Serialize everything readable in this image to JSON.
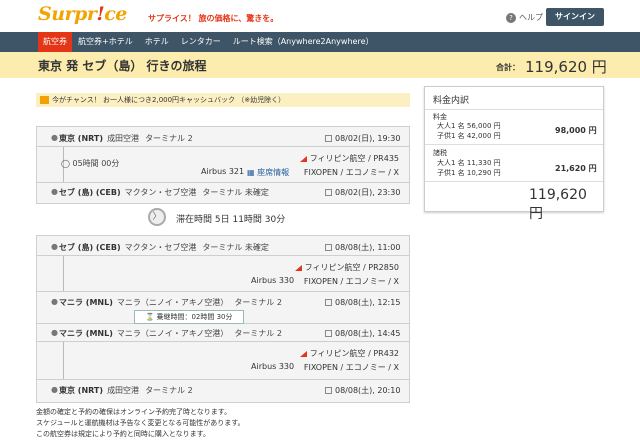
{
  "header": {
    "logo": "Surpr",
    "logo_ex": "!",
    "logo_tail": "ce",
    "tagline": "サプライス！ 旅の価格に、驚きを。",
    "help": "ヘルプ",
    "help_icon": "?",
    "signin": "サインイン"
  },
  "nav": [
    {
      "label": "航空券",
      "active": true
    },
    {
      "label": "航空券+ホテル",
      "active": false
    },
    {
      "label": "ホテル",
      "active": false
    },
    {
      "label": "レンタカー",
      "active": false
    },
    {
      "label": "ルート検索（Anywhere2Anywhere）",
      "active": false
    }
  ],
  "title": "東京 発 セブ（島） 行きの旅程",
  "total": {
    "label": "合計：",
    "value": "119,620 円"
  },
  "promo": "今がチャンス！ お一人様につき2,000円キャッシュバック （※幼児除く）",
  "outbound": {
    "from": {
      "city": "東京 (NRT)",
      "airport": "成田空港",
      "terminal": "ターミナル 2",
      "datetime": "08/02(日), 19:30"
    },
    "duration": "05時間 00分",
    "airline": "フィリピン航空",
    "flight": "PR435",
    "aircraft": "Airbus 321",
    "seat": "座席情報",
    "fare": "FIXOPEN",
    "cabin": "エコノミー",
    "cls": "X",
    "to": {
      "city": "セブ (島) (CEB)",
      "airport": "マクタン・セブ空港",
      "terminal": "ターミナル 未確定",
      "datetime": "08/02(日), 23:30"
    }
  },
  "stay": {
    "icon": "〉",
    "label": "滞在時間",
    "value": "5日 11時間 30分"
  },
  "return1": {
    "from": {
      "city": "セブ (島) (CEB)",
      "airport": "マクタン・セブ空港",
      "terminal": "ターミナル 未確定",
      "datetime": "08/08(土), 11:00"
    },
    "airline": "フィリピン航空",
    "flight": "PR2850",
    "aircraft": "Airbus 330",
    "fare": "FIXOPEN",
    "cabin": "エコノミー",
    "cls": "X",
    "to": {
      "city": "マニラ (MNL)",
      "airport": "マニラ（ニノイ・アキノ空港）",
      "terminal": "ターミナル 2",
      "datetime": "08/08(土), 12:15"
    }
  },
  "transfer": "乗継時間：02時間 30分",
  "return2": {
    "from": {
      "city": "マニラ (MNL)",
      "airport": "マニラ（ニノイ・アキノ空港）",
      "terminal": "ターミナル 2",
      "datetime": "08/08(土), 14:45"
    },
    "airline": "フィリピン航空",
    "flight": "PR432",
    "aircraft": "Airbus 330",
    "fare": "FIXOPEN",
    "cabin": "エコノミー",
    "cls": "X",
    "to": {
      "city": "東京 (NRT)",
      "airport": "成田空港",
      "terminal": "ターミナル 2",
      "datetime": "08/08(土), 20:10"
    }
  },
  "notes": [
    "金額の確定と予約の確保はオンライン予約完了時となります。",
    "スケジュールと運航機材は予告なく変更となる可能性があります。",
    "この航空券は規定により予約と同時に購入となります。"
  ],
  "price": {
    "title": "料金内訳",
    "fare_label": "料金",
    "fare_adult": "大人1 名 56,000 円",
    "fare_child": "子供1 名 42,000 円",
    "fare_total": "98,000 円",
    "tax_label": "諸税",
    "tax_adult": "大人1 名 11,330 円",
    "tax_child": "子供1 名 10,290 円",
    "tax_total": "21,620 円",
    "grand": "119,620 円"
  }
}
